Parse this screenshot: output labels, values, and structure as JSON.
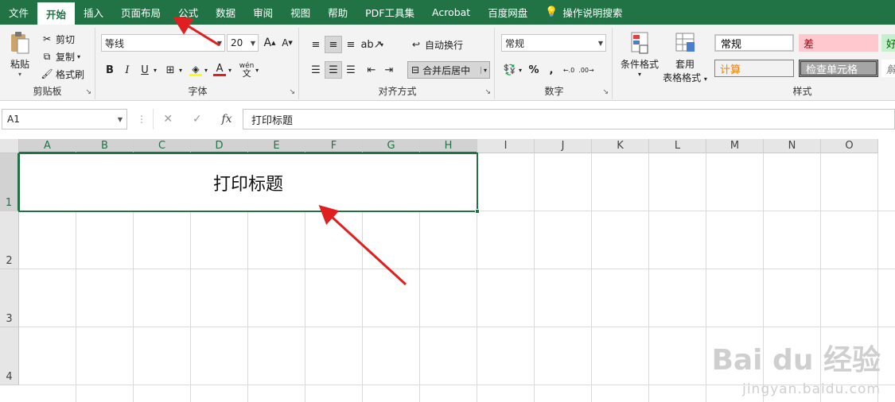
{
  "tabs": [
    "文件",
    "开始",
    "插入",
    "页面布局",
    "公式",
    "数据",
    "审阅",
    "视图",
    "帮助",
    "PDF工具集",
    "Acrobat",
    "百度网盘",
    "操作说明搜索"
  ],
  "active_tab": "开始",
  "clipboard": {
    "paste": "粘贴",
    "cut": "剪切",
    "copy": "复制",
    "format_painter": "格式刷",
    "label": "剪贴板"
  },
  "font": {
    "name": "等线",
    "size": "20",
    "label": "字体",
    "bold": "B",
    "italic": "I",
    "underline": "U",
    "grow": "A",
    "shrink": "A",
    "phonetic": "wén"
  },
  "alignment": {
    "wrap": "自动换行",
    "merge": "合并后居中",
    "label": "对齐方式"
  },
  "number": {
    "format": "常规",
    "percent": "%",
    "comma": ",",
    "label": "数字"
  },
  "styles": {
    "conditional": "条件格式",
    "table_format_1": "套用",
    "table_format_2": "表格格式",
    "label": "样式",
    "cells": [
      {
        "text": "常规",
        "bg": "#ffffff",
        "color": "#000000"
      },
      {
        "text": "差",
        "bg": "#ffc7ce",
        "color": "#9c0006"
      },
      {
        "text": "好",
        "bg": "#c6efce",
        "color": "#006100"
      },
      {
        "text": "计算",
        "bg": "#f2f2f2",
        "color": "#fa7d00"
      },
      {
        "text": "检查单元格",
        "bg": "#a5a5a5",
        "color": "#ffffff"
      },
      {
        "text": "解",
        "bg": "#ffffff",
        "color": "#7f7f7f"
      }
    ]
  },
  "formula_bar": {
    "name_box": "A1",
    "cancel": "✕",
    "enter": "✓",
    "fx": "fx",
    "content": "打印标题"
  },
  "columns": [
    "A",
    "B",
    "C",
    "D",
    "E",
    "F",
    "G",
    "H",
    "I",
    "J",
    "K",
    "L",
    "M",
    "N",
    "O"
  ],
  "rows": [
    "1",
    "2",
    "3",
    "4"
  ],
  "merged_cell": {
    "text": "打印标题"
  },
  "watermark": {
    "main": "Bai du 经验",
    "sub": "jingyan.baidu.com"
  },
  "colors": {
    "accent": "#217346",
    "annotation": "#e02020"
  }
}
